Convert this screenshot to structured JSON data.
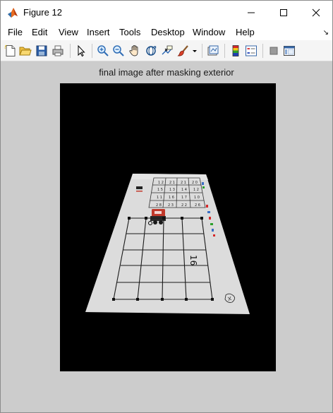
{
  "window": {
    "title": "Figure 12"
  },
  "menu": {
    "items": [
      "File",
      "Edit",
      "View",
      "Insert",
      "Tools",
      "Desktop",
      "Window",
      "Help"
    ],
    "dock_glyph": "↘"
  },
  "toolbar": {
    "icons": [
      "new-figure-icon",
      "open-file-icon",
      "save-icon",
      "print-icon",
      "select-arrow-icon",
      "zoom-in-icon",
      "zoom-out-icon",
      "pan-hand-icon",
      "rotate-3d-icon",
      "data-cursor-icon",
      "brush-icon",
      "brush-dropdown-icon",
      "link-plot-icon",
      "insert-colorbar-icon",
      "insert-legend-icon",
      "hide-plot-tools-icon",
      "show-plot-tools-icon"
    ]
  },
  "figure": {
    "axes_title": "final image after masking exterior",
    "image_background": "#000000",
    "grid_number": "16"
  },
  "colors": {
    "figure_bg": "#cccccc",
    "toolbar_bg": "#f5f5f5",
    "mat": "#dcdcdc",
    "robot": "#c0392b"
  }
}
